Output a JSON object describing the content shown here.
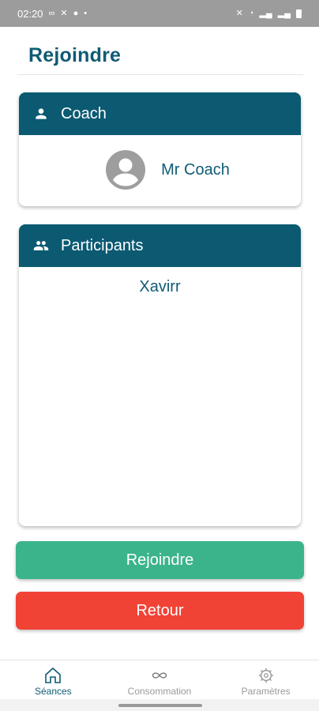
{
  "status_bar": {
    "time": "02:20"
  },
  "header": {
    "title": "Rejoindre"
  },
  "coach_card": {
    "title": "Coach",
    "coach_name": "Mr Coach"
  },
  "participants_card": {
    "title": "Participants",
    "participants": [
      "Xavirr"
    ]
  },
  "buttons": {
    "join_label": "Rejoindre",
    "back_label": "Retour"
  },
  "bottom_nav": {
    "items": [
      {
        "label": "Séances",
        "icon": "home-icon",
        "active": true
      },
      {
        "label": "Consommation",
        "icon": "infinity-icon",
        "active": false
      },
      {
        "label": "Paramètres",
        "icon": "gear-icon",
        "active": false
      }
    ]
  },
  "colors": {
    "primary": "#0b5a72",
    "title_text": "#0f5b74",
    "join_button": "#3bb48c",
    "back_button": "#f04336",
    "status_bar": "#9c9c9c"
  }
}
